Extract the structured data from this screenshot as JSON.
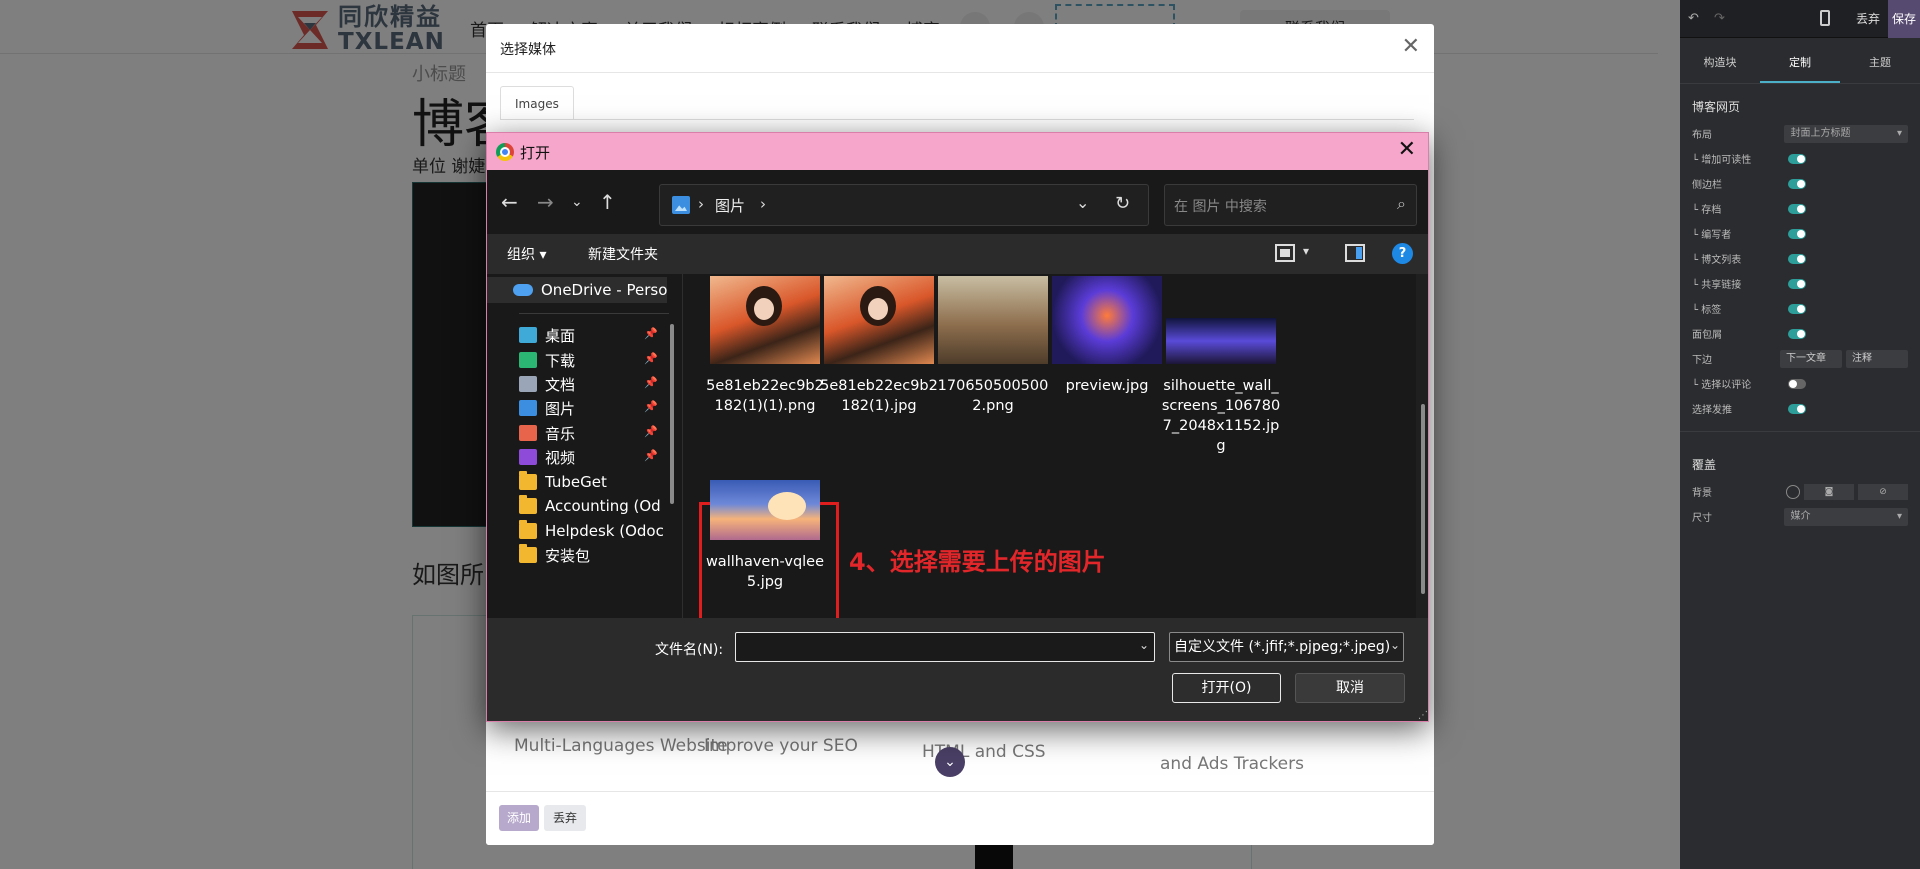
{
  "site": {
    "logo_cn": "同欣精益",
    "logo_en": "TXLEAN",
    "nav": [
      "首页",
      "解决方案",
      "关于我们",
      "标杆案例",
      "联系我们",
      "博客"
    ],
    "contact_button": "联系我们",
    "subtitle": "小标题",
    "title": "博客",
    "author_line": "单位 谢婕",
    "para_start": "如图所",
    "features": [
      "Multi-Languages Website",
      "Improve your SEO",
      "HTML and CSS",
      "and Ads Trackers"
    ]
  },
  "editor": {
    "discard": "丢弃",
    "save": "保存",
    "tabs": [
      "构造块",
      "定制",
      "主题"
    ],
    "section1_title": "博客网页",
    "rows": [
      {
        "label": "布局",
        "type": "select",
        "value": "封面上方标题"
      },
      {
        "label": "└ 增加可读性",
        "type": "toggle",
        "on": true
      },
      {
        "label": "侧边栏",
        "type": "toggle",
        "on": true
      },
      {
        "label": "└ 存档",
        "type": "toggle",
        "on": true
      },
      {
        "label": "└ 编写者",
        "type": "toggle",
        "on": true
      },
      {
        "label": "└ 博文列表",
        "type": "toggle",
        "on": true
      },
      {
        "label": "└ 共享链接",
        "type": "toggle",
        "on": true
      },
      {
        "label": "└ 标签",
        "type": "toggle",
        "on": true
      },
      {
        "label": "面包屑",
        "type": "toggle",
        "on": true
      },
      {
        "label": "下边",
        "type": "pair",
        "values": [
          "下一文章",
          "注释"
        ]
      },
      {
        "label": "└ 选择以评论",
        "type": "toggle",
        "on": false
      },
      {
        "label": "选择发推",
        "type": "toggle",
        "on": true
      }
    ],
    "section2_title": "覆盖",
    "bg_label": "背景",
    "size_label": "尺寸",
    "size_value": "媒介"
  },
  "media_modal": {
    "title": "选择媒体",
    "tab": "Images",
    "add_button": "添加",
    "discard_button": "丢弃"
  },
  "dialog": {
    "title": "打开",
    "path": "图片",
    "search_placeholder": "在 图片 中搜索",
    "organize": "组织 ▾",
    "new_folder": "新建文件夹",
    "help": "?",
    "nav_items": [
      {
        "label": "OneDrive - Perso",
        "icon": "onedrive-cloud-icon",
        "color": "#4ea0f0"
      },
      {
        "label": "桌面",
        "icon": "desktop-icon",
        "color": "#3fa9d8",
        "pinned": true
      },
      {
        "label": "下载",
        "icon": "download-icon",
        "color": "#2bb673",
        "pinned": true
      },
      {
        "label": "文档",
        "icon": "document-icon",
        "color": "#9aa6b8",
        "pinned": true
      },
      {
        "label": "图片",
        "icon": "pictures-icon",
        "color": "#3b8ee0",
        "pinned": true
      },
      {
        "label": "音乐",
        "icon": "music-icon",
        "color": "#e8654b",
        "pinned": true
      },
      {
        "label": "视频",
        "icon": "video-icon",
        "color": "#8e4ad8",
        "pinned": true
      },
      {
        "label": "TubeGet",
        "icon": "folder-icon",
        "color": "#f2b72e"
      },
      {
        "label": "Accounting (Od",
        "icon": "folder-icon",
        "color": "#f2b72e"
      },
      {
        "label": "Helpdesk (Odoc",
        "icon": "folder-icon",
        "color": "#f2b72e"
      },
      {
        "label": "安装包",
        "icon": "folder-icon",
        "color": "#f2b72e"
      }
    ],
    "files": [
      {
        "name": "5e81eb22ec9b2182(1)(1).png",
        "thumb": "th-girl"
      },
      {
        "name": "5e81eb22ec9b2182(1).jpg",
        "thumb": "th-girl"
      },
      {
        "name": "1706505005002.png",
        "thumb": "th-cafe"
      },
      {
        "name": "preview.jpg",
        "thumb": "th-preview"
      },
      {
        "name": "silhouette_wall_screens_1067807_2048x1152.jpg",
        "thumb": "th-sil"
      },
      {
        "name": "wallhaven-vqlee5.jpg",
        "thumb": "th-wall"
      }
    ],
    "annotation": "4、选择需要上传的图片",
    "filename_label": "文件名(N):",
    "filename_value": "",
    "filter": "自定义文件 (*.jfif;*.pjpeg;*.jpeg)",
    "open_button": "打开(O)",
    "cancel_button": "取消"
  }
}
